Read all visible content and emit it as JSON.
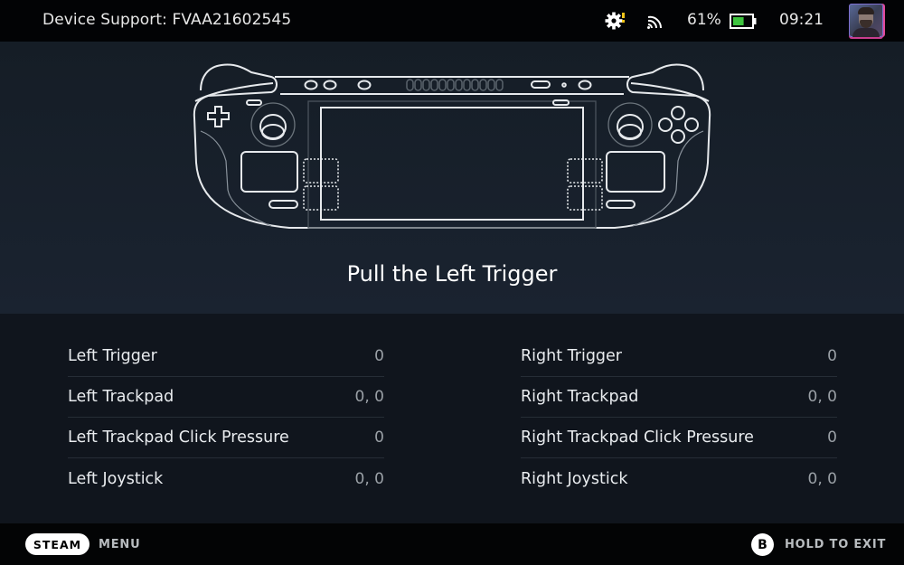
{
  "topbar": {
    "title": "Device Support: FVAA21602545",
    "status": {
      "settings_icon": "gear-alert-icon",
      "cast_icon": "cast-icon",
      "battery_percent": "61%",
      "battery_level": 0.61,
      "battery_icon": "battery-icon",
      "clock": "09:21",
      "avatar": "user-avatar"
    }
  },
  "hero": {
    "device_diagram": "steam-deck-outline",
    "prompt": "Pull the Left Trigger"
  },
  "readouts": {
    "left": [
      {
        "label": "Left Trigger",
        "value": "0"
      },
      {
        "label": "Left Trackpad",
        "value": "0, 0"
      },
      {
        "label": "Left Trackpad Click Pressure",
        "value": "0"
      },
      {
        "label": "Left Joystick",
        "value": "0, 0"
      }
    ],
    "right": [
      {
        "label": "Right Trigger",
        "value": "0"
      },
      {
        "label": "Right Trackpad",
        "value": "0, 0"
      },
      {
        "label": "Right Trackpad Click Pressure",
        "value": "0"
      },
      {
        "label": "Right Joystick",
        "value": "0, 0"
      }
    ]
  },
  "footer": {
    "steam_button": "STEAM",
    "menu_label": "MENU",
    "b_button": "B",
    "exit_label": "HOLD TO EXIT"
  },
  "colors": {
    "battery_fill": "#3ec43e",
    "alert_dot": "#f0c419",
    "avatar_frame": "#e24a9a",
    "outline": "#e6e9ec"
  }
}
